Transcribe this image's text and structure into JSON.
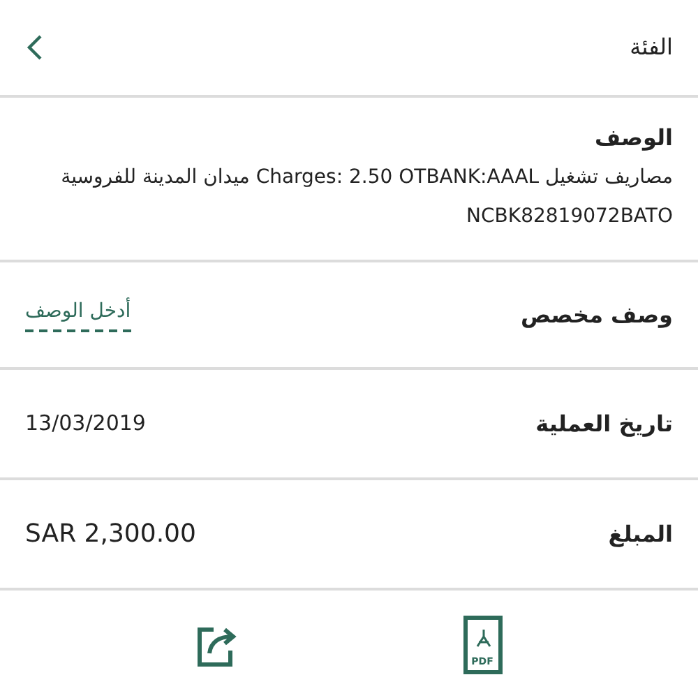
{
  "header": {
    "title": "الفئة"
  },
  "description": {
    "label": "الوصف",
    "text": "مصاريف تشغيل Charges: 2.50 OTBANK:AAAL ميدان المدينة للفروسية NCBK82819072BATO"
  },
  "custom_description": {
    "label": "وصف مخصص",
    "placeholder": "أدخل الوصف"
  },
  "fields": [
    {
      "label": "تاريخ العملية",
      "value": "13/03/2019"
    },
    {
      "label": "المبلغ",
      "value": "SAR 2,300.00"
    }
  ],
  "actions": {
    "pdf_label": "PDF"
  }
}
